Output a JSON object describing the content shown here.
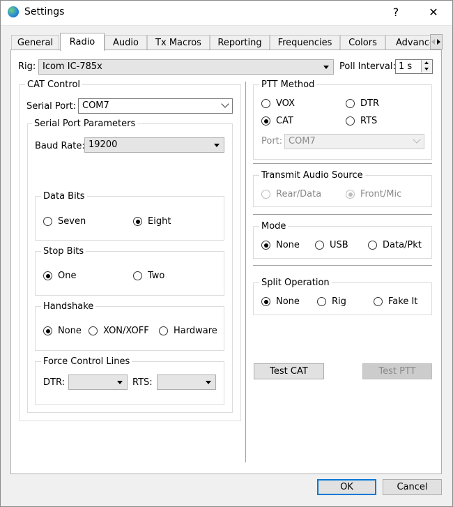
{
  "window": {
    "title": "Settings",
    "help_glyph": "?",
    "close_glyph": "✕"
  },
  "tabs": [
    {
      "label": "General"
    },
    {
      "label": "Radio"
    },
    {
      "label": "Audio"
    },
    {
      "label": "Tx Macros"
    },
    {
      "label": "Reporting"
    },
    {
      "label": "Frequencies"
    },
    {
      "label": "Colors"
    },
    {
      "label": "Advanced"
    }
  ],
  "active_tab": "Radio",
  "rig": {
    "label": "Rig:",
    "value": "Icom IC-785x"
  },
  "poll": {
    "label": "Poll Interval:",
    "value": "1 s"
  },
  "cat": {
    "title": "CAT Control",
    "serial_port_label": "Serial Port:",
    "serial_port_value": "COM7",
    "params": {
      "title": "Serial Port Parameters",
      "baud_label": "Baud Rate:",
      "baud_value": "19200",
      "data_bits": {
        "title": "Data Bits",
        "options": [
          "Seven",
          "Eight"
        ],
        "selected": "Eight"
      },
      "stop_bits": {
        "title": "Stop Bits",
        "options": [
          "One",
          "Two"
        ],
        "selected": "One"
      },
      "handshake": {
        "title": "Handshake",
        "options": [
          "None",
          "XON/XOFF",
          "Hardware"
        ],
        "selected": "None"
      },
      "force": {
        "title": "Force Control Lines",
        "dtr_label": "DTR:",
        "rts_label": "RTS:",
        "dtr_value": "",
        "rts_value": ""
      }
    }
  },
  "ptt": {
    "title": "PTT Method",
    "options": [
      "VOX",
      "DTR",
      "CAT",
      "RTS"
    ],
    "selected": "CAT",
    "port_label": "Port:",
    "port_value": "COM7"
  },
  "tx_audio": {
    "title": "Transmit Audio Source",
    "options": [
      "Rear/Data",
      "Front/Mic"
    ],
    "selected": "Front/Mic"
  },
  "mode": {
    "title": "Mode",
    "options": [
      "None",
      "USB",
      "Data/Pkt"
    ],
    "selected": "None"
  },
  "split": {
    "title": "Split Operation",
    "options": [
      "None",
      "Rig",
      "Fake It"
    ],
    "selected": "None"
  },
  "buttons": {
    "test_cat": "Test CAT",
    "test_ptt": "Test PTT",
    "ok": "OK",
    "cancel": "Cancel"
  },
  "colors": {
    "accent": "#0078d7",
    "panel": "#ffffff",
    "background": "#f0f0f0"
  }
}
